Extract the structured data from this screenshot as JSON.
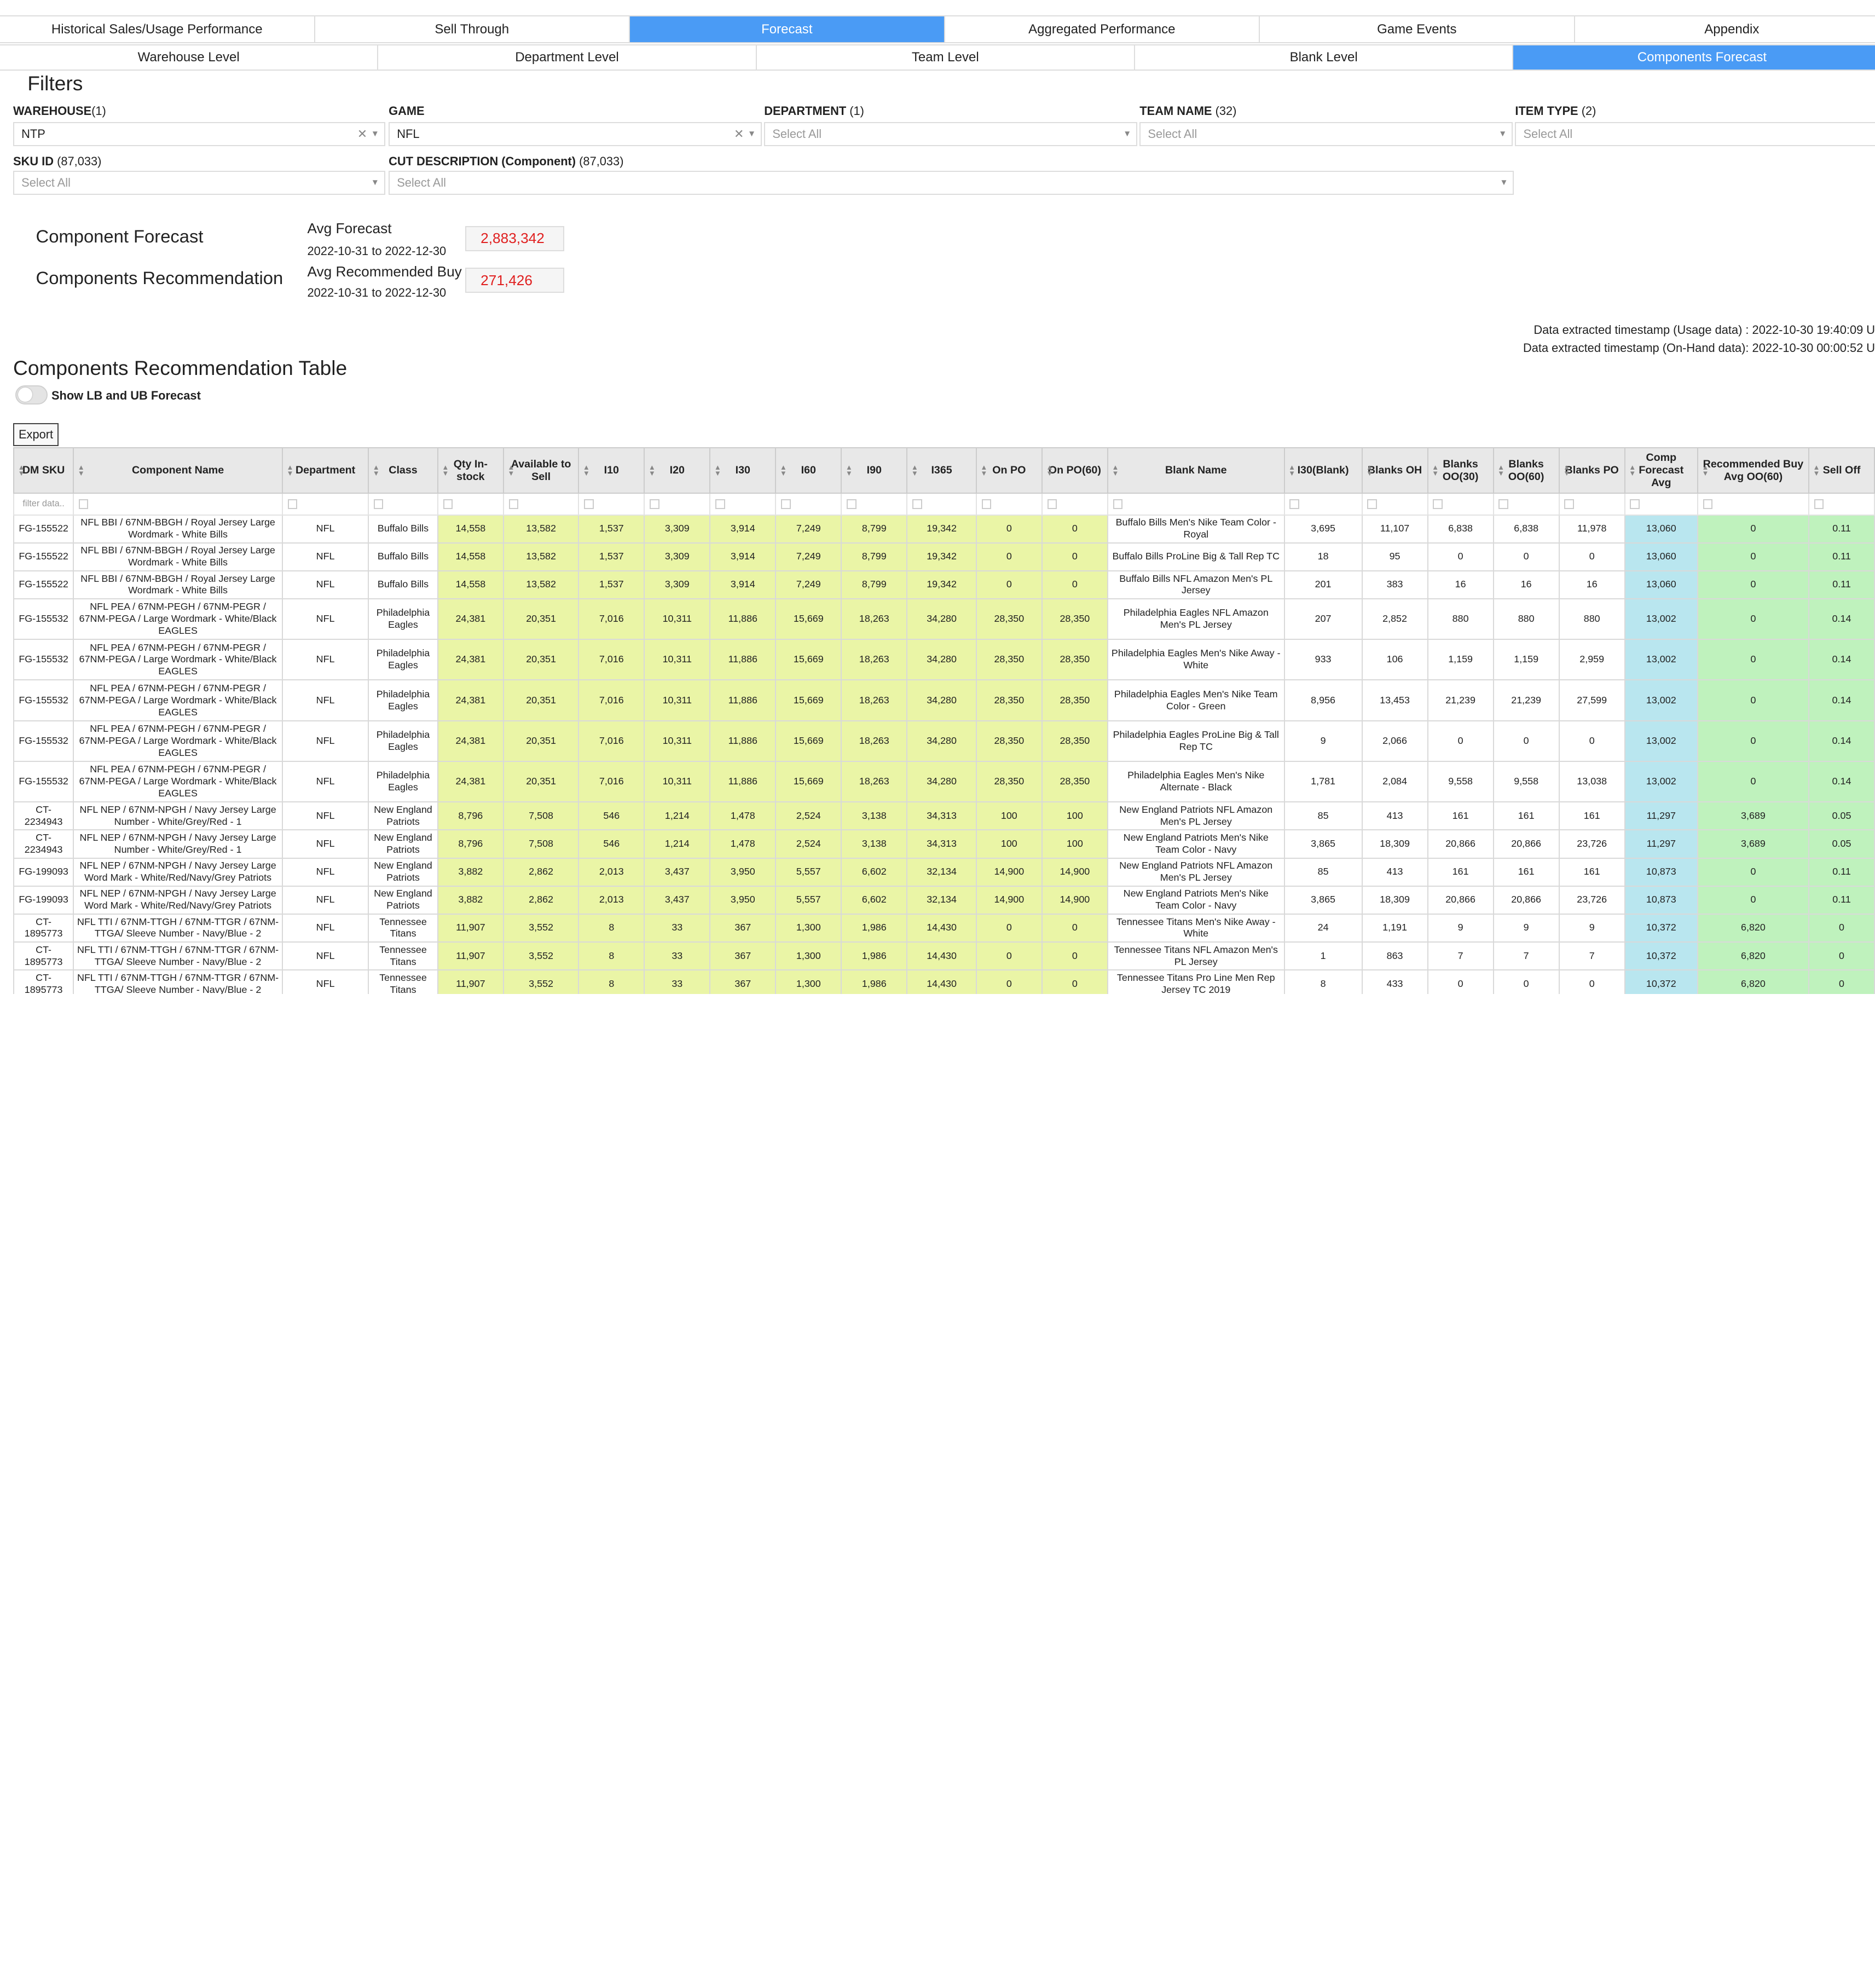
{
  "nav_main": [
    "Historical Sales/Usage Performance",
    "Sell Through",
    "Forecast",
    "Aggregated Performance",
    "Game Events",
    "Appendix"
  ],
  "nav_sub": [
    "Warehouse Level",
    "Department Level",
    "Team Level",
    "Blank Level",
    "Components Forecast"
  ],
  "filters": {
    "title": "Filters",
    "warehouse": {
      "label": "WAREHOUSE",
      "count": "(1)",
      "value": "NTP"
    },
    "game": {
      "label": "GAME",
      "value": "NFL"
    },
    "department": {
      "label": "DEPARTMENT",
      "count": "(1)",
      "placeholder": "Select All"
    },
    "team_name": {
      "label": "TEAM NAME",
      "count": "(32)",
      "placeholder": "Select All"
    },
    "item_type": {
      "label": "ITEM TYPE",
      "count": "(2)",
      "placeholder": "Select All"
    },
    "sku_id": {
      "label": "SKU ID",
      "count": "(87,033)",
      "placeholder": "Select All"
    },
    "cut_description": {
      "label": "CUT DESCRIPTION (Component)",
      "count": "(87,033)",
      "placeholder": "Select All"
    }
  },
  "kpis": {
    "component_forecast": {
      "label": "Component Forecast",
      "sub": "Avg Forecast",
      "range": "2022-10-31 to 2022-12-30",
      "value": "2,883,342"
    },
    "components_recommendation": {
      "label": "Components Recommendation",
      "sub": "Avg Recommended Buy",
      "range": "2022-10-31 to 2022-12-30",
      "value": "271,426"
    }
  },
  "timestamps": {
    "usage": "Data extracted timestamp (Usage data) : 2022-10-30 19:40:09 U",
    "onhand": "Data extracted timestamp (On-Hand data): 2022-10-30 00:00:52 U"
  },
  "table_title": "Components Recommendation Table",
  "toggle_label": "Show LB and UB Forecast",
  "export_label": "Export",
  "filter_placeholder": "filter data..",
  "columns": [
    "DM SKU",
    "Component Name",
    "Department",
    "Class",
    "Qty In-stock",
    "Available to Sell",
    "I10",
    "I20",
    "I30",
    "I60",
    "I90",
    "I365",
    "On PO",
    "On PO(60)",
    "Blank Name",
    "I30(Blank)",
    "Blanks OH",
    "Blanks OO(30)",
    "Blanks OO(60)",
    "Blanks PO",
    "Comp Forecast Avg",
    "Recommended Buy Avg OO(60)",
    "Sell Off"
  ],
  "rows": [
    [
      "FG-155522",
      "NFL BBI / 67NM-BBGH / Royal Jersey Large Wordmark - White Bills",
      "NFL",
      "Buffalo Bills",
      "14,558",
      "13,582",
      "1,537",
      "3,309",
      "3,914",
      "7,249",
      "8,799",
      "19,342",
      "0",
      "0",
      "Buffalo Bills Men's Nike Team Color - Royal",
      "3,695",
      "11,107",
      "6,838",
      "6,838",
      "11,978",
      "13,060",
      "0",
      "0.11"
    ],
    [
      "FG-155522",
      "NFL BBI / 67NM-BBGH / Royal Jersey Large Wordmark - White Bills",
      "NFL",
      "Buffalo Bills",
      "14,558",
      "13,582",
      "1,537",
      "3,309",
      "3,914",
      "7,249",
      "8,799",
      "19,342",
      "0",
      "0",
      "Buffalo Bills ProLine Big & Tall Rep TC",
      "18",
      "95",
      "0",
      "0",
      "0",
      "13,060",
      "0",
      "0.11"
    ],
    [
      "FG-155522",
      "NFL BBI / 67NM-BBGH / Royal Jersey Large Wordmark - White Bills",
      "NFL",
      "Buffalo Bills",
      "14,558",
      "13,582",
      "1,537",
      "3,309",
      "3,914",
      "7,249",
      "8,799",
      "19,342",
      "0",
      "0",
      "Buffalo Bills NFL Amazon Men's PL Jersey",
      "201",
      "383",
      "16",
      "16",
      "16",
      "13,060",
      "0",
      "0.11"
    ],
    [
      "FG-155532",
      "NFL PEA / 67NM-PEGH / 67NM-PEGR / 67NM-PEGA / Large Wordmark - White/Black EAGLES",
      "NFL",
      "Philadelphia Eagles",
      "24,381",
      "20,351",
      "7,016",
      "10,311",
      "11,886",
      "15,669",
      "18,263",
      "34,280",
      "28,350",
      "28,350",
      "Philadelphia Eagles NFL Amazon Men's PL Jersey",
      "207",
      "2,852",
      "880",
      "880",
      "880",
      "13,002",
      "0",
      "0.14"
    ],
    [
      "FG-155532",
      "NFL PEA / 67NM-PEGH / 67NM-PEGR / 67NM-PEGA / Large Wordmark - White/Black EAGLES",
      "NFL",
      "Philadelphia Eagles",
      "24,381",
      "20,351",
      "7,016",
      "10,311",
      "11,886",
      "15,669",
      "18,263",
      "34,280",
      "28,350",
      "28,350",
      "Philadelphia Eagles Men's Nike Away - White",
      "933",
      "106",
      "1,159",
      "1,159",
      "2,959",
      "13,002",
      "0",
      "0.14"
    ],
    [
      "FG-155532",
      "NFL PEA / 67NM-PEGH / 67NM-PEGR / 67NM-PEGA / Large Wordmark - White/Black EAGLES",
      "NFL",
      "Philadelphia Eagles",
      "24,381",
      "20,351",
      "7,016",
      "10,311",
      "11,886",
      "15,669",
      "18,263",
      "34,280",
      "28,350",
      "28,350",
      "Philadelphia Eagles Men's Nike Team Color - Green",
      "8,956",
      "13,453",
      "21,239",
      "21,239",
      "27,599",
      "13,002",
      "0",
      "0.14"
    ],
    [
      "FG-155532",
      "NFL PEA / 67NM-PEGH / 67NM-PEGR / 67NM-PEGA / Large Wordmark - White/Black EAGLES",
      "NFL",
      "Philadelphia Eagles",
      "24,381",
      "20,351",
      "7,016",
      "10,311",
      "11,886",
      "15,669",
      "18,263",
      "34,280",
      "28,350",
      "28,350",
      "Philadelphia Eagles ProLine Big & Tall Rep TC",
      "9",
      "2,066",
      "0",
      "0",
      "0",
      "13,002",
      "0",
      "0.14"
    ],
    [
      "FG-155532",
      "NFL PEA / 67NM-PEGH / 67NM-PEGR / 67NM-PEGA / Large Wordmark - White/Black EAGLES",
      "NFL",
      "Philadelphia Eagles",
      "24,381",
      "20,351",
      "7,016",
      "10,311",
      "11,886",
      "15,669",
      "18,263",
      "34,280",
      "28,350",
      "28,350",
      "Philadelphia Eagles Men's Nike Alternate - Black",
      "1,781",
      "2,084",
      "9,558",
      "9,558",
      "13,038",
      "13,002",
      "0",
      "0.14"
    ],
    [
      "CT-2234943",
      "NFL NEP / 67NM-NPGH / Navy Jersey Large Number - White/Grey/Red - 1",
      "NFL",
      "New England Patriots",
      "8,796",
      "7,508",
      "546",
      "1,214",
      "1,478",
      "2,524",
      "3,138",
      "34,313",
      "100",
      "100",
      "New England Patriots NFL Amazon Men's PL Jersey",
      "85",
      "413",
      "161",
      "161",
      "161",
      "11,297",
      "3,689",
      "0.05"
    ],
    [
      "CT-2234943",
      "NFL NEP / 67NM-NPGH / Navy Jersey Large Number - White/Grey/Red - 1",
      "NFL",
      "New England Patriots",
      "8,796",
      "7,508",
      "546",
      "1,214",
      "1,478",
      "2,524",
      "3,138",
      "34,313",
      "100",
      "100",
      "New England Patriots Men's Nike Team Color - Navy",
      "3,865",
      "18,309",
      "20,866",
      "20,866",
      "23,726",
      "11,297",
      "3,689",
      "0.05"
    ],
    [
      "FG-199093",
      "NFL NEP / 67NM-NPGH / Navy Jersey Large Word Mark - White/Red/Navy/Grey Patriots",
      "NFL",
      "New England Patriots",
      "3,882",
      "2,862",
      "2,013",
      "3,437",
      "3,950",
      "5,557",
      "6,602",
      "32,134",
      "14,900",
      "14,900",
      "New England Patriots NFL Amazon Men's PL Jersey",
      "85",
      "413",
      "161",
      "161",
      "161",
      "10,873",
      "0",
      "0.11"
    ],
    [
      "FG-199093",
      "NFL NEP / 67NM-NPGH / Navy Jersey Large Word Mark - White/Red/Navy/Grey Patriots",
      "NFL",
      "New England Patriots",
      "3,882",
      "2,862",
      "2,013",
      "3,437",
      "3,950",
      "5,557",
      "6,602",
      "32,134",
      "14,900",
      "14,900",
      "New England Patriots Men's Nike Team Color - Navy",
      "3,865",
      "18,309",
      "20,866",
      "20,866",
      "23,726",
      "10,873",
      "0",
      "0.11"
    ],
    [
      "CT-1895773",
      "NFL TTI / 67NM-TTGH / 67NM-TTGR / 67NM-TTGA/ Sleeve Number - Navy/Blue - 2",
      "NFL",
      "Tennessee Titans",
      "11,907",
      "3,552",
      "8",
      "33",
      "367",
      "1,300",
      "1,986",
      "14,430",
      "0",
      "0",
      "Tennessee Titans Men's Nike Away - White",
      "24",
      "1,191",
      "9",
      "9",
      "9",
      "10,372",
      "6,820",
      "0"
    ],
    [
      "CT-1895773",
      "NFL TTI / 67NM-TTGH / 67NM-TTGR / 67NM-TTGA/ Sleeve Number - Navy/Blue - 2",
      "NFL",
      "Tennessee Titans",
      "11,907",
      "3,552",
      "8",
      "33",
      "367",
      "1,300",
      "1,986",
      "14,430",
      "0",
      "0",
      "Tennessee Titans NFL Amazon Men's PL Jersey",
      "1",
      "863",
      "7",
      "7",
      "7",
      "10,372",
      "6,820",
      "0"
    ],
    [
      "CT-1895773",
      "NFL TTI / 67NM-TTGH / 67NM-TTGR / 67NM-TTGA/ Sleeve Number - Navy/Blue - 2",
      "NFL",
      "Tennessee Titans",
      "11,907",
      "3,552",
      "8",
      "33",
      "367",
      "1,300",
      "1,986",
      "14,430",
      "0",
      "0",
      "Tennessee Titans Pro Line Men Rep Jersey TC 2019",
      "8",
      "433",
      "0",
      "0",
      "0",
      "10,372",
      "6,820",
      "0"
    ]
  ]
}
